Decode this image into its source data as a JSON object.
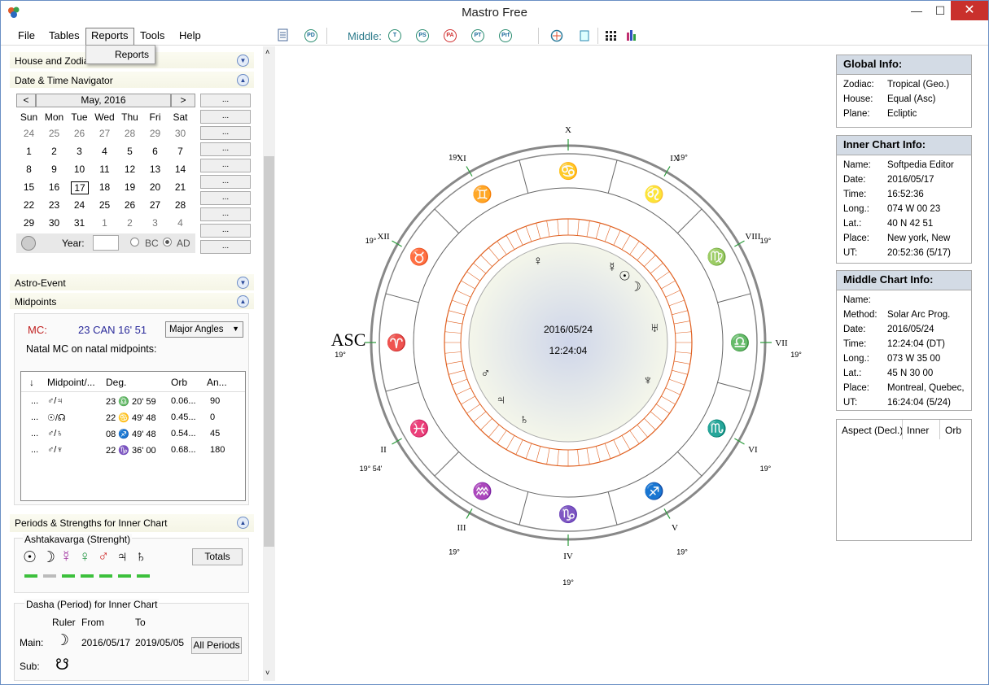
{
  "window": {
    "title": "Mastro Free",
    "minimize": "—",
    "maximize": "☐",
    "close": "✕"
  },
  "menu": {
    "items": [
      "File",
      "Tables",
      "Reports",
      "Tools",
      "Help"
    ],
    "dropdown_item": "Reports"
  },
  "toolbar": {
    "middle_label": "Middle:",
    "buttons": [
      "PD",
      "T",
      "PS",
      "PA",
      "PT",
      "Prf"
    ]
  },
  "panels": {
    "house_zodiac": "House and Zodiac",
    "date_nav": "Date & Time Navigator",
    "astro_event": "Astro-Event",
    "midpoints": "Midpoints",
    "periods": "Periods & Strengths  for Inner Chart"
  },
  "calendar": {
    "month": "May, 2016",
    "prev": "<",
    "next": ">",
    "days": [
      "Sun",
      "Mon",
      "Tue",
      "Wed",
      "Thu",
      "Fri",
      "Sat"
    ],
    "weeks": [
      [
        "24",
        "25",
        "26",
        "27",
        "28",
        "29",
        "30"
      ],
      [
        "1",
        "2",
        "3",
        "4",
        "5",
        "6",
        "7"
      ],
      [
        "8",
        "9",
        "10",
        "11",
        "12",
        "13",
        "14"
      ],
      [
        "15",
        "16",
        "17",
        "18",
        "19",
        "20",
        "21"
      ],
      [
        "22",
        "23",
        "24",
        "25",
        "26",
        "27",
        "28"
      ],
      [
        "29",
        "30",
        "31",
        "1",
        "2",
        "3",
        "4"
      ]
    ],
    "year_label": "Year:",
    "bc": "BC",
    "ad": "AD",
    "side_btn": "..."
  },
  "midpoints": {
    "mc_label": "MC:",
    "mc_value": "23 CAN 16' 51",
    "select": "Major Angles",
    "desc": "Natal MC on natal midpoints:",
    "headers": [
      "↓",
      "Midpoint/...",
      "Deg.",
      "Orb",
      "An..."
    ],
    "rows": [
      [
        "...",
        "♂/♃",
        "23 ♎ 20' 59",
        "0.06...",
        "90"
      ],
      [
        "...",
        "☉/☊",
        "22 ♋ 49' 48",
        "0.45...",
        "0"
      ],
      [
        "...",
        "♂/♄",
        "08 ♐ 49' 48",
        "0.54...",
        "45"
      ],
      [
        "...",
        "♂/♆",
        "22 ♑ 36' 00",
        "0.68...",
        "180"
      ]
    ]
  },
  "ashtakavarga": {
    "title": "Ashtakavarga  (Strenght)",
    "totals": "Totals",
    "planets": [
      "☉",
      "☽",
      "☿",
      "♀",
      "♂",
      "♃",
      "♄"
    ]
  },
  "dasha": {
    "title": "Dasha (Period) for Inner Chart",
    "ruler": "Ruler",
    "from": "From",
    "to": "To",
    "main_label": "Main:",
    "main_glyph": "☽",
    "main_from": "2016/05/17",
    "main_to": "2019/05/05",
    "all_periods": "All Periods",
    "sub_label": "Sub:",
    "sub_glyph": "☋"
  },
  "chart": {
    "date": "2016/05/24",
    "time": "12:24:04",
    "houses": [
      "X",
      "XI",
      "XII",
      "ASC",
      "II",
      "III",
      "IV",
      "V",
      "VI",
      "VII",
      "VIII",
      "IX"
    ],
    "house_degrees": [
      "19°",
      "19°",
      "19°",
      "19° 54'",
      "19°",
      "19°",
      "19°",
      "19°",
      "19°",
      "19°",
      "19°"
    ]
  },
  "global_info": {
    "title": "Global Info:",
    "rows": [
      [
        "Zodiac:",
        "Tropical (Geo.)"
      ],
      [
        "House:",
        "Equal (Asc)"
      ],
      [
        "Plane:",
        "Ecliptic"
      ]
    ]
  },
  "inner_info": {
    "title": "Inner Chart Info:",
    "rows": [
      [
        "Name:",
        "Softpedia Editor"
      ],
      [
        "Date:",
        "2016/05/17"
      ],
      [
        "Time:",
        "16:52:36"
      ],
      [
        "Long.:",
        "074 W 00 23"
      ],
      [
        "Lat.:",
        "40 N 42 51"
      ],
      [
        "Place:",
        "New york, New"
      ],
      [
        "UT:",
        "20:52:36 (5/17)"
      ]
    ]
  },
  "middle_info": {
    "title": "Middle Chart Info:",
    "rows": [
      [
        "Name:",
        ""
      ],
      [
        "Method:",
        "Solar Arc Prog."
      ],
      [
        "Date:",
        "2016/05/24"
      ],
      [
        "Time:",
        "12:24:04  (DT)"
      ],
      [
        "Long.:",
        "073 W 35 00"
      ],
      [
        "Lat.:",
        "45 N 30 00"
      ],
      [
        "Place:",
        "Montreal, Quebec,"
      ],
      [
        "UT:",
        "16:24:04 (5/24)"
      ]
    ]
  },
  "aspect": {
    "headers": [
      "Aspect (Decl.)",
      "Inner",
      "Orb"
    ]
  },
  "colors": {
    "accent": "#3a7fc4",
    "header": "#d3dbe5",
    "orange": "#e06020"
  }
}
